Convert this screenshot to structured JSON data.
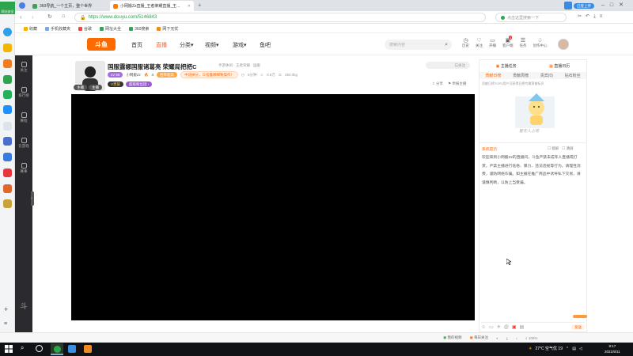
{
  "browser": {
    "tabs": [
      {
        "label": "360导航_一个主页，整个世界"
      },
      {
        "label": "小网搬Zz直播_王者荣耀直播_王..."
      }
    ],
    "address": "https://www.douyu.com/5146843",
    "address_secure": "https",
    "search_placeholder": "点击这里搜索一下",
    "app_tag": "已登上传",
    "bookmarks": [
      "收藏",
      "手机收藏夹",
      "谷歌",
      "网址大全",
      "360搜索",
      "网下无忧"
    ]
  },
  "sidebar360": {
    "badge": "网址安全"
  },
  "douyu": {
    "logo": "斗鱼",
    "nav": [
      "首页",
      "直播",
      "分类",
      "视频",
      "游戏",
      "鱼吧"
    ],
    "search_placeholder": "搜索内容",
    "header_icons": [
      "历史",
      "关注",
      "开播",
      "客户端",
      "任务",
      "创作中心"
    ],
    "header_badge": "1",
    "left_nav": [
      "关注",
      "排行榜",
      "赛程",
      "云游戏",
      "赛事"
    ]
  },
  "room": {
    "title": "国服露娜国服诸葛亮 荣耀局把把C",
    "category": "手游休闲 · 王者荣耀 · 国服",
    "follow_button": "已关注",
    "streamer": "小网搬Zz",
    "level": "LV 56",
    "hot": "4",
    "rank_label": "胜率超高",
    "notice1": "中途掉分，三指露娜细致操作！",
    "stats": [
      "5分钟",
      "0.8万",
      "250.0kg"
    ],
    "share": "分享",
    "report": "举报主播",
    "fan_badge": "粉丝团",
    "vip_label": "V贵族",
    "fans_button": "超级粉丝团 ›",
    "avatar_label_1": "主播",
    "avatar_label_2": "主播"
  },
  "right_panel": {
    "top_tabs": [
      "主播任务",
      "直播日历"
    ],
    "tabs": [
      "贡献日榜",
      "贡献周榜",
      "贵宾(0)",
      "钻石粉丝"
    ],
    "rank_hint": "贡献日榜TOP3用户可获得日榜专属荣誉标识",
    "empty_text": "暂无人上榜",
    "system_label": "系统提示:",
    "system_text": "欢迎来到小网搬Zz的直播间，斗鱼严禁未成年人直播或打赏，严禁主播进行低俗、暴力、违法违规等行为，请理性消费，谨防网络诈骗。如主播在推广商品中诱导私下交易，请谨慎判断，以防上当受骗。",
    "chk_screen": "锁屏",
    "chk_clear": "清屏",
    "send_button": "发送"
  },
  "statusbar": {
    "items": [
      "我的视频",
      "每日关注",
      "100%"
    ]
  },
  "taskbar": {
    "weather": "27°C 空气优 19",
    "time": "8:17",
    "date": "2021/9/11"
  }
}
